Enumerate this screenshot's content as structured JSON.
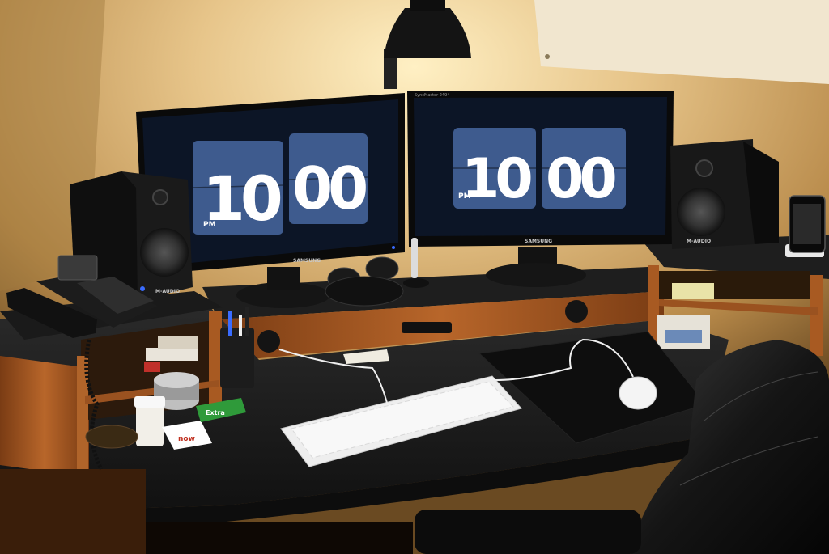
{
  "left_monitor": {
    "brand": "SAMSUNG",
    "clock": {
      "hours": "10",
      "minutes": "00",
      "meridiem": "PM"
    }
  },
  "right_monitor": {
    "model": "SyncMaster 2494",
    "brand": "SAMSUNG",
    "clock": {
      "hours": "10",
      "minutes": "00",
      "meridiem": "PM"
    }
  },
  "left_speaker": {
    "brand": "M-AUDIO"
  },
  "right_speaker": {
    "brand": "M-AUDIO"
  },
  "gum_pack": {
    "label": "Extra"
  },
  "card": {
    "label": "now"
  },
  "colors": {
    "wall": "#e8c88a",
    "desk_top": "#1c1c1c",
    "desk_wood": "#a85a22",
    "clock_tile": "#3e5b8e",
    "monitor_screen": "#0c1526"
  }
}
